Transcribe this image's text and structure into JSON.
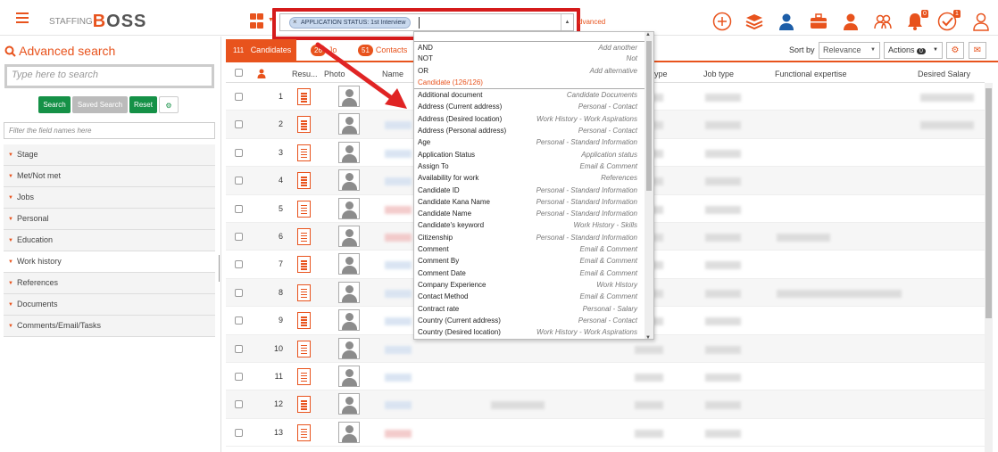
{
  "header": {
    "logo_prefix": "STAFFING",
    "logo_b": "B",
    "logo_rest": "OSS",
    "query_chip": "APPLICATION STATUS: 1st Interview",
    "advanced_link": "dvanced",
    "notif_badge": "0",
    "tasks_badge": "1"
  },
  "left": {
    "title": "Advanced search",
    "search_placeholder": "Type here to search",
    "buttons": {
      "search": "Search",
      "saved": "Saved Search",
      "reset": "Reset"
    },
    "filter_placeholder": "Filter the field names here",
    "facets": [
      "Stage",
      "Met/Not met",
      "Jobs",
      "Personal",
      "Education",
      "Work history",
      "References",
      "Documents",
      "Comments/Email/Tasks"
    ]
  },
  "tabs": [
    {
      "count": "111",
      "label": "Candidates"
    },
    {
      "count": "26",
      "label": "Jo"
    },
    {
      "count": "51",
      "label": "Contacts"
    }
  ],
  "toolbar": {
    "sort_label": "Sort by",
    "sort_value": "Relevance",
    "actions_label": "Actions",
    "actions_count": "0"
  },
  "table": {
    "headers": [
      "Resu...",
      "Photo",
      "Name",
      "ype",
      "Job type",
      "Functional expertise",
      "Desired Salary"
    ],
    "rows": [
      "1",
      "2",
      "3",
      "4",
      "5",
      "6",
      "7",
      "8",
      "9",
      "10",
      "11",
      "12",
      "13"
    ]
  },
  "dropdown": {
    "top_items": [
      {
        "name": "AND",
        "cat": "Add another"
      },
      {
        "name": "NOT",
        "cat": "Not"
      },
      {
        "name": "OR",
        "cat": "Add alternative"
      }
    ],
    "section": "Candidate (126/126)",
    "items": [
      {
        "name": "Additional document",
        "cat": "Candidate Documents"
      },
      {
        "name": "Address (Current address)",
        "cat": "Personal - Contact"
      },
      {
        "name": "Address (Desired location)",
        "cat": "Work History - Work Aspirations"
      },
      {
        "name": "Address (Personal address)",
        "cat": "Personal - Contact"
      },
      {
        "name": "Age",
        "cat": "Personal - Standard Information"
      },
      {
        "name": "Application Status",
        "cat": "Application status"
      },
      {
        "name": "Assign To",
        "cat": "Email & Comment"
      },
      {
        "name": "Availability for work",
        "cat": "References"
      },
      {
        "name": "Candidate ID",
        "cat": "Personal - Standard Information"
      },
      {
        "name": "Candidate Kana Name",
        "cat": "Personal - Standard Information"
      },
      {
        "name": "Candidate Name",
        "cat": "Personal - Standard Information"
      },
      {
        "name": "Candidate's keyword",
        "cat": "Work History - Skills"
      },
      {
        "name": "Citizenship",
        "cat": "Personal - Standard Information"
      },
      {
        "name": "Comment",
        "cat": "Email & Comment"
      },
      {
        "name": "Comment By",
        "cat": "Email & Comment"
      },
      {
        "name": "Comment Date",
        "cat": "Email & Comment"
      },
      {
        "name": "Company Experience",
        "cat": "Work History"
      },
      {
        "name": "Contact Method",
        "cat": "Email & Comment"
      },
      {
        "name": "Contract rate",
        "cat": "Personal - Salary"
      },
      {
        "name": "Country (Current address)",
        "cat": "Personal - Contact"
      },
      {
        "name": "Country (Desired location)",
        "cat": "Work History - Work Aspirations"
      }
    ]
  },
  "colors": {
    "accent": "#e8531d",
    "highlight": "#d51b1b",
    "button_green": "#159147"
  }
}
